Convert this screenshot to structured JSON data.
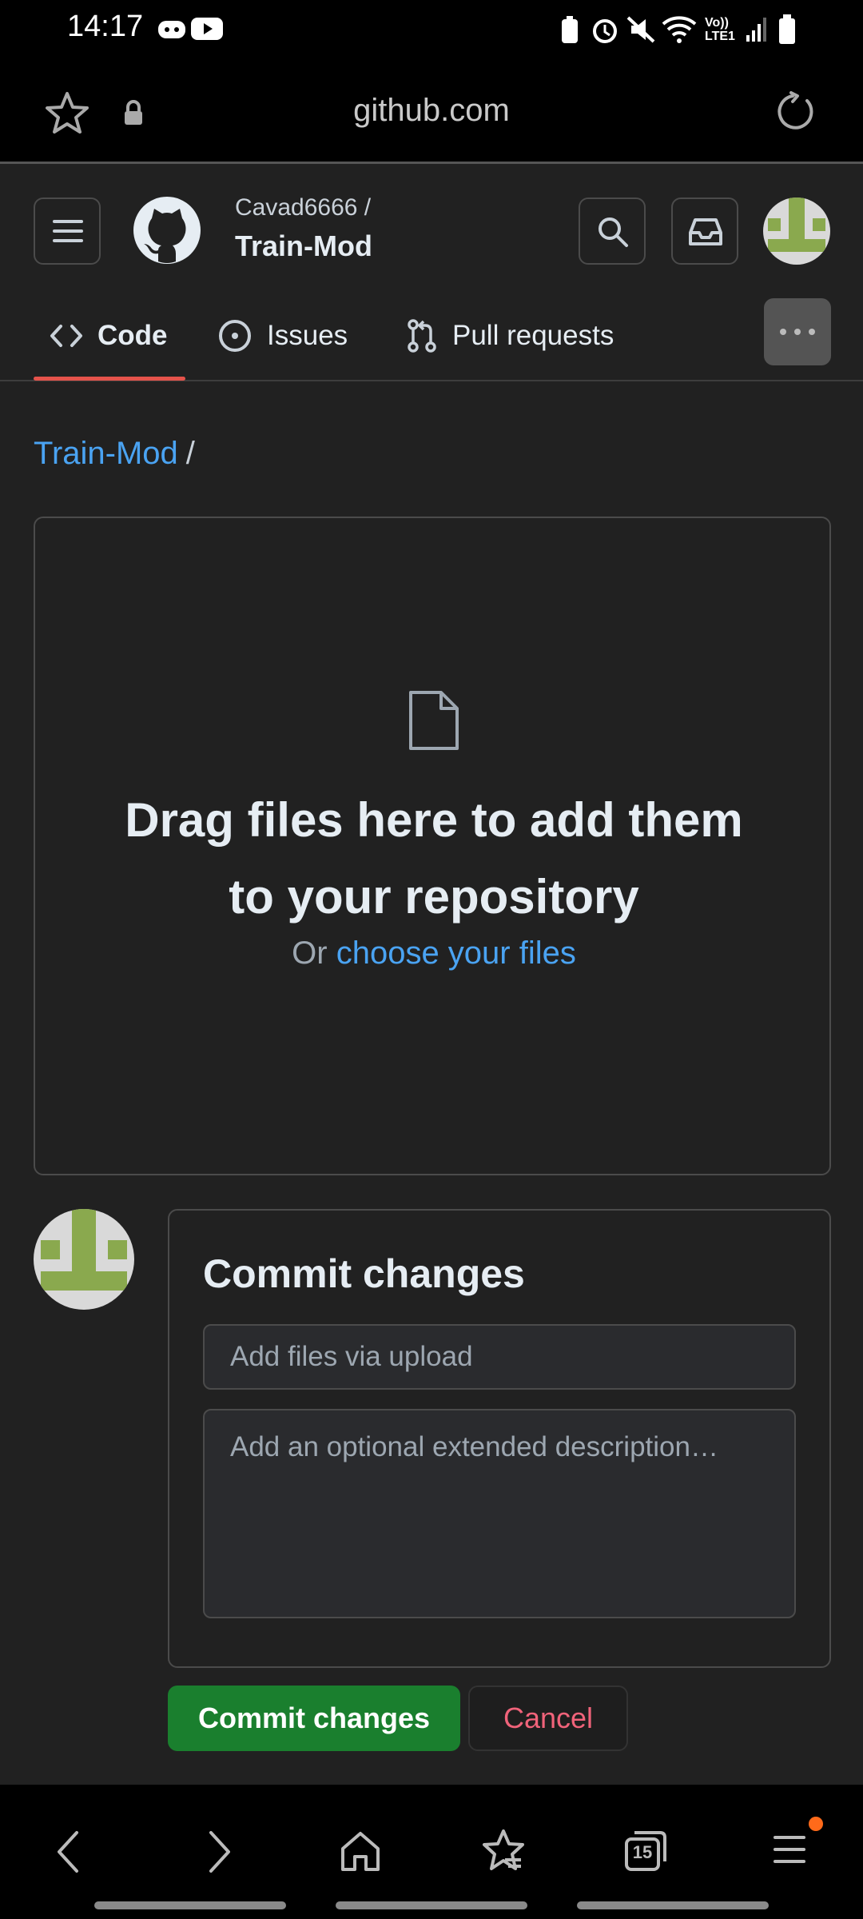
{
  "status_bar": {
    "time": "14:17",
    "network_label": "Vo)) LTE1"
  },
  "browser": {
    "url": "github.com"
  },
  "repo_header": {
    "owner": "Cavad6666 /",
    "repo": "Train-Mod"
  },
  "tabs": [
    {
      "label": "Code",
      "active": true
    },
    {
      "label": "Issues"
    },
    {
      "label": "Pull requests"
    }
  ],
  "breadcrumb": {
    "repo": "Train-Mod",
    "separator": "/"
  },
  "drop_area": {
    "title_line1": "Drag files here to add them",
    "title_line2": "to your repository",
    "or_text": "Or",
    "choose_link": "choose your files"
  },
  "commit": {
    "title": "Commit changes",
    "summary_placeholder": "Add files via upload",
    "description_placeholder": "Add an optional extended description…",
    "commit_button": "Commit changes",
    "cancel_button": "Cancel"
  },
  "bottom_nav": {
    "tabs_count": "15"
  },
  "colors": {
    "accent_link": "#4aa3f2",
    "commit_green": "#1a7f2e",
    "cancel_red": "#f0637a",
    "tab_underline": "#e5534b",
    "avatar_green": "#8aa94e"
  }
}
